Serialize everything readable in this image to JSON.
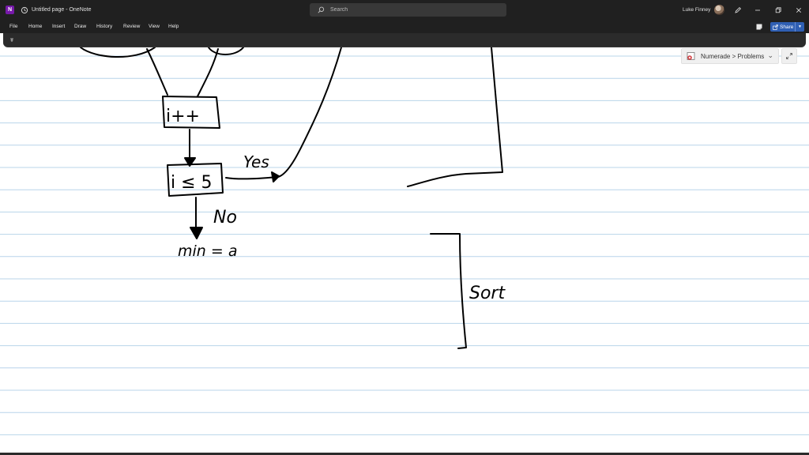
{
  "window": {
    "title": "Untitled page - OneNote",
    "app_icon_letter": "N",
    "search_placeholder": "Search",
    "user_name": "Luke Finney"
  },
  "menu": {
    "items": [
      "File",
      "Home",
      "Insert",
      "Draw",
      "History",
      "Review",
      "View",
      "Help"
    ],
    "share_label": "Share"
  },
  "notebook": {
    "breadcrumb": "Numerade > Problems"
  },
  "ink": {
    "box_increment": "i++",
    "box_condition": "i ≤ 5",
    "label_yes": "Yes",
    "label_no": "No",
    "assignment": "min = a",
    "label_sort": "Sort"
  },
  "colors": {
    "chrome": "#202020",
    "accent_share": "#2f5fb3",
    "rule_line": "#b8d4ea",
    "ink": "#000000"
  }
}
